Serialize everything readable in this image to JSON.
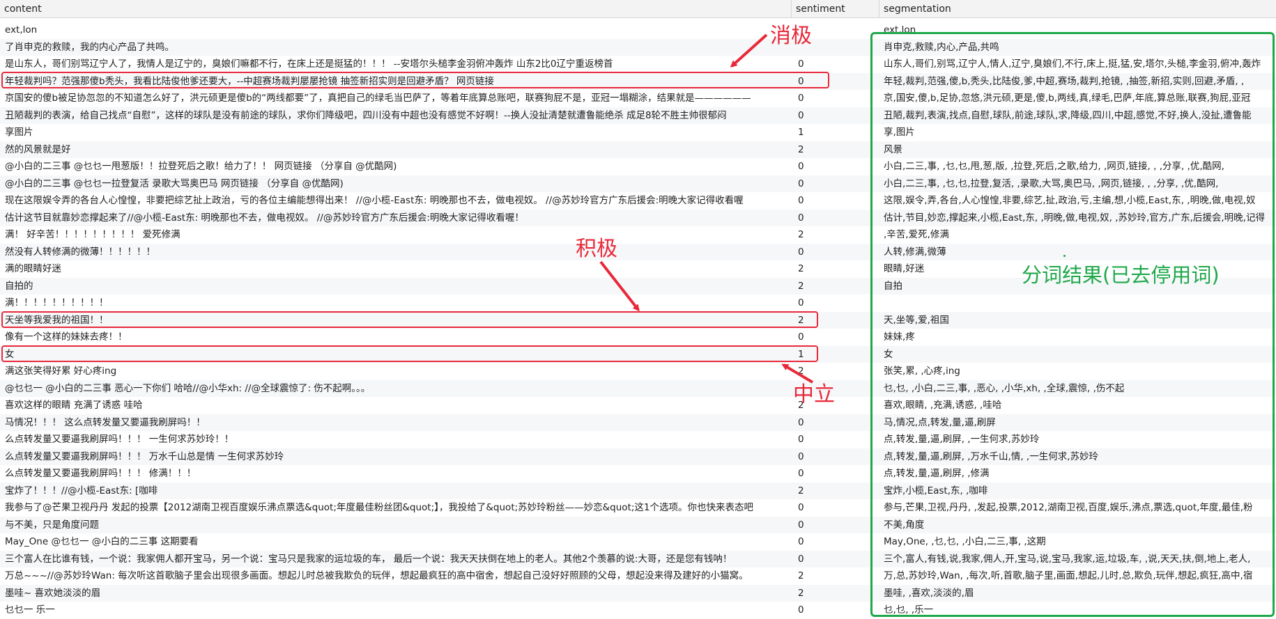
{
  "columns": {
    "content": "content",
    "sentiment": "sentiment",
    "segmentation": "segmentation"
  },
  "rows": [
    {
      "content": "ext,lon",
      "sentiment": "",
      "segmentation": "ext,lon"
    },
    {
      "content": "了肖申克的救赎，我的内心产品了共鸣。",
      "sentiment": "",
      "segmentation": "肖申克,救赎,内心,产品,共鸣"
    },
    {
      "content": "是山东人，哥们别骂辽宁人了，我情人是辽宁的，臭娘们嘛都不行，在床上还是挺猛的！！！ --安塔尔头槌李金羽俯冲轰炸 山东2比0辽宁重返榜首",
      "sentiment": "0",
      "segmentation": "山东人,哥们,别骂,辽宁人,情人,辽宁,臭娘们,不行,床上,挺,猛,安,塔尔,头槌,李金羽,俯冲,轰炸"
    },
    {
      "content": "年轻裁判吗？范强那傻b秃头，我看比陆俊他爹还要大，--中超赛场裁判屡屡抢镜 抽签新招实则是回避矛盾？  网页链接",
      "sentiment": "0",
      "segmentation": "年轻,裁判,范强,傻,b,秃头,比陆俊,爹,中超,赛场,裁判,抢镜, ,抽签,新招,实则,回避,矛盾, ,"
    },
    {
      "content": "京国安的傻b被足协忽忽的不知道怎么好了，洪元硕更是傻b的“两线都要”了，真把自己的绿毛当巴萨了，等着年底算总账吧，联赛狗屁不是，亚冠一塌糊涂，结果就是——————",
      "sentiment": "0",
      "segmentation": "京,国安,傻,b,足协,忽悠,洪元硕,更是,傻,b,两线,真,绿毛,巴萨,年底,算总账,联赛,狗屁,亚冠"
    },
    {
      "content": "丑陋裁判的表演，给自己找点“自慰”，这样的球队是没有前途的球队，求你们降级吧，四川没有中超也没有感觉不好啊！--换人没扯清楚就遭鲁能绝杀 成足8轮不胜主帅很郁闷",
      "sentiment": "0",
      "segmentation": "丑陋,裁判,表演,找点,自慰,球队,前途,球队,求,降级,四川,中超,感觉,不好,换人,没扯,遭鲁能"
    },
    {
      "content": "享图片",
      "sentiment": "1",
      "segmentation": "享,图片"
    },
    {
      "content": "然的风景就是好",
      "sentiment": "2",
      "segmentation": "风景"
    },
    {
      "content": "@小白的二三事 @乜乜一甩葱版！！拉登死后之歌！给力了！！ 网页链接 （分享自 @优酷网)",
      "sentiment": "0",
      "segmentation": "小白,二三,事, ,乜,乜,甩,葱,版, ,拉登,死后,之歌,给力, ,网页,链接, , ,分享, ,优,酷网,"
    },
    {
      "content": "@小白的二三事 @乜乜一拉登复活 录歌大骂奥巴马 网页链接 （分享自 @优酷网)",
      "sentiment": "0",
      "segmentation": "小白,二三,事, ,乜,乜,拉登,复活, ,录歌,大骂,奥巴马, ,网页,链接, , ,分享, ,优,酷网,"
    },
    {
      "content": "现在这限娱令弄的各台人心惶惶，非要把综艺扯上政治，亏的各位主编能想得出来！ //@小榄-East东: 明晚那也不去，做电视奴。 //@苏妙玲官方广东后援会:明晚大家记得收看喔",
      "sentiment": "0",
      "segmentation": "这限,娱令,弄,各台,人心惶惶,非要,综艺,扯,政治,亏,主编,想,小榄,East,东, ,明晚,做,电视,奴"
    },
    {
      "content": "估计这节目就靠妙恋撑起来了//@小榄-East东: 明晚那也不去，做电视奴。 //@苏妙玲官方广东后援会:明晚大家记得收看喔！",
      "sentiment": "0",
      "segmentation": "估计,节目,妙恋,撑起来,小榄,East,东, ,明晚,做,电视,奴, ,苏妙玲,官方,广东,后援会,明晚,记得"
    },
    {
      "content": "满！ 好辛苦！！！！！！！！！ 爱死修满",
      "sentiment": "2",
      "segmentation": " ,辛苦,爱死,修满"
    },
    {
      "content": "然没有人转修满的微薄！！！！！！",
      "sentiment": "0",
      "segmentation": "人转,修满,微薄"
    },
    {
      "content": "满的眼睛好迷",
      "sentiment": "2",
      "segmentation": "眼睛,好迷"
    },
    {
      "content": "自拍的",
      "sentiment": "2",
      "segmentation": "自拍"
    },
    {
      "content": "满！！！！！！！！！！",
      "sentiment": "0",
      "segmentation": ""
    },
    {
      "content": "天坐等我爱我的祖国！！",
      "sentiment": "2",
      "segmentation": "天,坐等,爱,祖国"
    },
    {
      "content": "像有一个这样的妹妹去疼！！",
      "sentiment": "0",
      "segmentation": "妹妹,疼"
    },
    {
      "content": "女",
      "sentiment": "1",
      "segmentation": "女"
    },
    {
      "content": "满这张笑得好累 好心疼ing",
      "sentiment": "2",
      "segmentation": "张笑,累, ,心疼,ing"
    },
    {
      "content": "@乜乜一 @小白的二三事 恶心一下你们 哈哈//@小华xh: //@全球震惊了: 伤不起啊。。。",
      "sentiment": "",
      "segmentation": "乜,乜, ,小白,二三,事, ,恶心, ,小华,xh, ,全球,震惊, ,伤不起"
    },
    {
      "content": "喜欢这样的眼睛 充满了诱惑 哇哈",
      "sentiment": "2",
      "segmentation": "喜欢,眼睛, ,充满,诱惑, ,哇哈"
    },
    {
      "content": "马情况！！！ 这么点转发量又要逼我刷屏吗！！",
      "sentiment": "0",
      "segmentation": "马,情况,点,转发,量,逼,刷屏"
    },
    {
      "content": "么点转发量又要逼我刷屏吗！！！ 一生何求苏妙玲！！",
      "sentiment": "0",
      "segmentation": "点,转发,量,逼,刷屏, ,一生何求,苏妙玲"
    },
    {
      "content": "么点转发量又要逼我刷屏吗！！！ 万水千山总是情 一生何求苏妙玲",
      "sentiment": "0",
      "segmentation": "点,转发,量,逼,刷屏, ,万水千山,情, ,一生何求,苏妙玲"
    },
    {
      "content": "么点转发量又要逼我刷屏吗！！！ 修满！！！",
      "sentiment": "0",
      "segmentation": "点,转发,量,逼,刷屏, ,修满"
    },
    {
      "content": "宝炸了！！！//@小榄-East东: [咖啡",
      "sentiment": "2",
      "segmentation": "宝炸,小榄,East,东, ,咖啡"
    },
    {
      "content": "我参与了@芒果卫视丹丹 发起的投票【2012湖南卫视百度娱乐沸点票选&quot;年度最佳粉丝团&quot;】，我投给了&quot;苏妙玲粉丝——妙恋&quot;这1个选项。你也快来表态吧",
      "sentiment": "0",
      "segmentation": "参与,芒果,卫视,丹丹, ,发起,投票,2012,湖南卫视,百度,娱乐,沸点,票选,quot,年度,最佳,粉"
    },
    {
      "content": "与不美，只是角度问题",
      "sentiment": "0",
      "segmentation": "不美,角度"
    },
    {
      "content": "May_One @乜乜一 @小白的二三事 这期要看",
      "sentiment": "0",
      "segmentation": "May,One, ,乜,乜, ,小白,二三,事, ,这期"
    },
    {
      "content": "三个富人在比谁有钱，一个说：我家佣人都开宝马，另一个说：宝马只是我家的运垃圾的车，  最后一个说：我天天扶倒在地上的老人。其他2个羡慕的说:大哥，还是您有钱呐！",
      "sentiment": "0",
      "segmentation": "三个,富人,有钱,说,我家,佣人,开,宝马,说,宝马,我家,运,垃圾,车, ,说,天天,扶,倒,地上,老人,"
    },
    {
      "content": "万总~~~//@苏妙玲Wan: 每次听这首歌脑子里会出现很多画面。想起儿时总被我欺负的玩伴，想起最疯狂的高中宿舍，想起自己没好好照顾的父母，想起没来得及建好的小猫窝。",
      "sentiment": "2",
      "segmentation": "万,总,苏妙玲,Wan, ,每次,听,首歌,脑子里,画面,想起,儿时,总,欺负,玩伴,想起,疯狂,高中,宿"
    },
    {
      "content": "墨哇~ 喜欢她淡淡的眉",
      "sentiment": "2",
      "segmentation": "墨哇, ,喜欢,淡淡的,眉"
    },
    {
      "content": "乜乜一 乐一",
      "sentiment": "0",
      "segmentation": "乜,乜, ,乐一"
    }
  ],
  "annotations": {
    "negative": "消极",
    "positive": "积极",
    "neutral": "中立",
    "segmentation_note": "分词结果(已去停用词)"
  },
  "colors": {
    "highlight_red": "#e8293a",
    "highlight_green": "#1fa84a"
  }
}
